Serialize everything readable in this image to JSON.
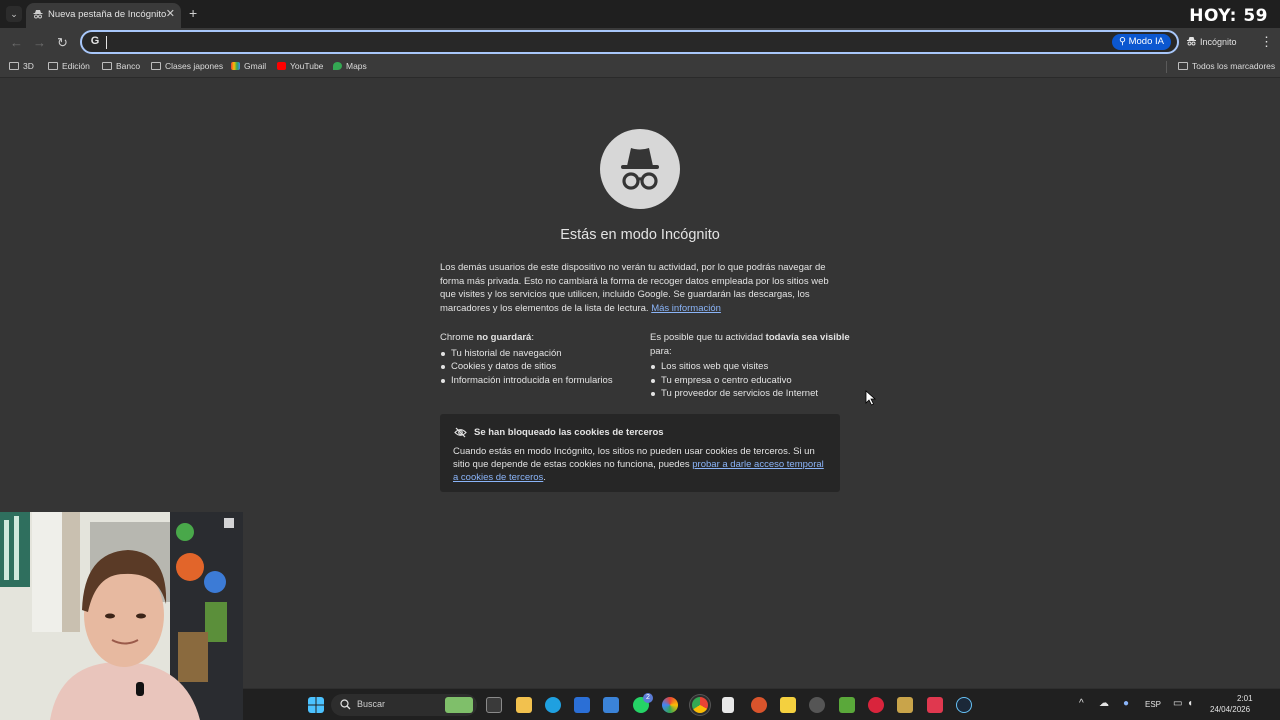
{
  "browser": {
    "tab_title": "Nueva pestaña de Incógnito",
    "tab_close": "✕",
    "new_tab": "+",
    "overlay_counter": "HOY: 59",
    "omnibox": {
      "value": "",
      "modo_ia_label": "Modo IA"
    },
    "incognito_chip": "Incógnito"
  },
  "bookmarks": {
    "items": [
      "3D",
      "Edición",
      "Banco",
      "Clases japones",
      "Gmail",
      "YouTube",
      "Maps"
    ],
    "all_bookmarks": "Todos los marcadores"
  },
  "content": {
    "title": "Estás en modo Incógnito",
    "intro": "Los demás usuarios de este dispositivo no verán tu actividad, por lo que podrás navegar de forma más privada. Esto no cambiará la forma de recoger datos empleada por los sitios web que visites y los servicios que utilicen, incluido Google. Se guardarán las descargas, los marcadores y los elementos de la lista de lectura.",
    "intro_link": "Más información",
    "left_head_prefix": "Chrome ",
    "left_head_bold": "no guardará",
    "left_head_suffix": ":",
    "left_items": [
      "Tu historial de navegación",
      "Cookies y datos de sitios",
      "Información introducida en formularios"
    ],
    "right_head_prefix": "Es posible que tu actividad ",
    "right_head_bold": "todavía sea visible",
    "right_head_suffix": " para:",
    "right_items": [
      "Los sitios web que visites",
      "Tu empresa o centro educativo",
      "Tu proveedor de servicios de Internet"
    ],
    "cookie_title": "Se han bloqueado las cookies de terceros",
    "cookie_body": "Cuando estás en modo Incógnito, los sitios no pueden usar cookies de terceros. Si un sitio que depende de estas cookies no funciona, puedes ",
    "cookie_link": "probar a darle acceso temporal a cookies de terceros",
    "cookie_end": "."
  },
  "taskbar": {
    "search_placeholder": "Buscar",
    "whatsapp_badge": "2",
    "language": "ESP",
    "time": "2:01",
    "date": "24/04/2026"
  },
  "colors": {
    "page_bg": "#353535",
    "link": "#8ab4f8",
    "accent": "#0b57d0",
    "omnibox_border": "#a8c7fa"
  }
}
